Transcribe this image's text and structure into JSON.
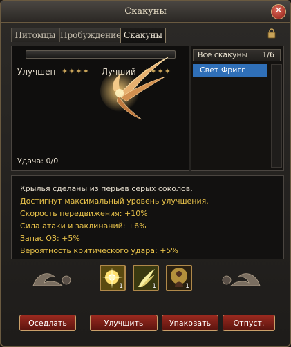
{
  "window": {
    "title": "Скакуны"
  },
  "tabs": [
    {
      "label": "Питомцы"
    },
    {
      "label": "Пробуждение"
    },
    {
      "label": "Скакуны"
    }
  ],
  "active_tab": "Скакуны",
  "mount_panel": {
    "label_current": "Улучшен",
    "label_best": "Лучший",
    "stars_current": 4,
    "stars_best": 4,
    "luck_text": "Удача: 0/0"
  },
  "mount_list": {
    "header_label": "Все скакуны",
    "count": "1/6",
    "items": [
      {
        "label": "Свет Фригг"
      }
    ]
  },
  "description": {
    "lines": [
      {
        "text": "Крылья сделаны из перьев серых соколов.",
        "color": "#e8e0d0"
      },
      {
        "text": "Достигнут максимальный уровень улучшения.",
        "color": "#e8c24a"
      },
      {
        "text": "Скорость передвижения: +10%",
        "color": "#e8c24a"
      },
      {
        "text": "Сила атаки и заклинаний: +6%",
        "color": "#e8c24a"
      },
      {
        "text": "Запас ОЗ: +5%",
        "color": "#e8c24a"
      },
      {
        "text": "Вероятность критического удара: +5%",
        "color": "#e8c24a"
      }
    ]
  },
  "item_slots": [
    {
      "icon": "light-burst-icon",
      "count": "1"
    },
    {
      "icon": "wing-feather-icon",
      "count": "1"
    },
    {
      "icon": "glowing-figure-icon",
      "count": "1"
    }
  ],
  "buttons": {
    "mount": "Оседлать",
    "upgrade": "Улучшить",
    "pack": "Упаковать",
    "release": "Отпуст."
  }
}
